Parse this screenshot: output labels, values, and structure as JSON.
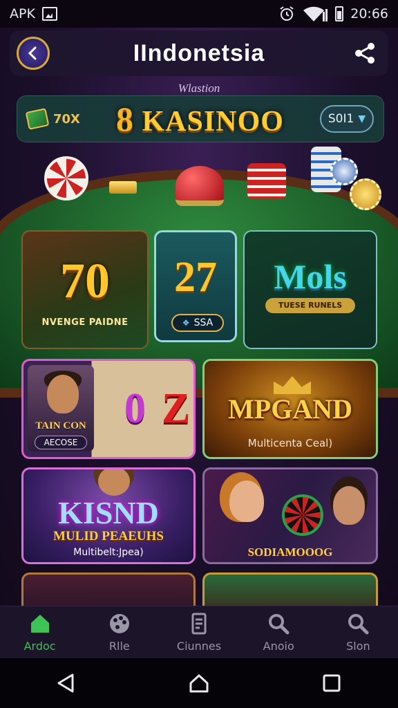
{
  "status_bar": {
    "carrier": "APK",
    "time": "20:66"
  },
  "app_bar": {
    "title": "IIndonetsia"
  },
  "subtitle": "Wlastion",
  "brand_bar": {
    "cash_label": "70X",
    "brand": "KASINOO",
    "brand_prefix": "8",
    "pill_label": "S0I1"
  },
  "cards": [
    {
      "title": "70",
      "caption": "NVENGE PAIDNE"
    },
    {
      "title": "27",
      "pill": "SSA"
    },
    {
      "title": "Mols",
      "caption": "TUESE RUNELS"
    },
    {
      "title_reels": [
        "0",
        "Z"
      ],
      "caption_top": "TAIN CON",
      "caption_pill": "AECOSE"
    },
    {
      "title": "MPGAND",
      "caption": "Multicenta Ceal)"
    },
    {
      "title": "KISND",
      "caption_top": "MULID PEAEUHS",
      "caption": "Multibelt:Jpea)"
    },
    {
      "caption": "SODIAMOOOG"
    }
  ],
  "bottom_nav": [
    {
      "label": "Ardoc",
      "icon": "home-icon",
      "active": true
    },
    {
      "label": "Rlle",
      "icon": "palette-icon",
      "active": false
    },
    {
      "label": "Ciunnes",
      "icon": "list-icon",
      "active": false
    },
    {
      "label": "Anoio",
      "icon": "search-icon",
      "active": false
    },
    {
      "label": "Slon",
      "icon": "search-icon",
      "active": false
    }
  ],
  "colors": {
    "accent_green": "#3fc256",
    "gold": "#ffc72c",
    "background": "#1a0f24"
  }
}
